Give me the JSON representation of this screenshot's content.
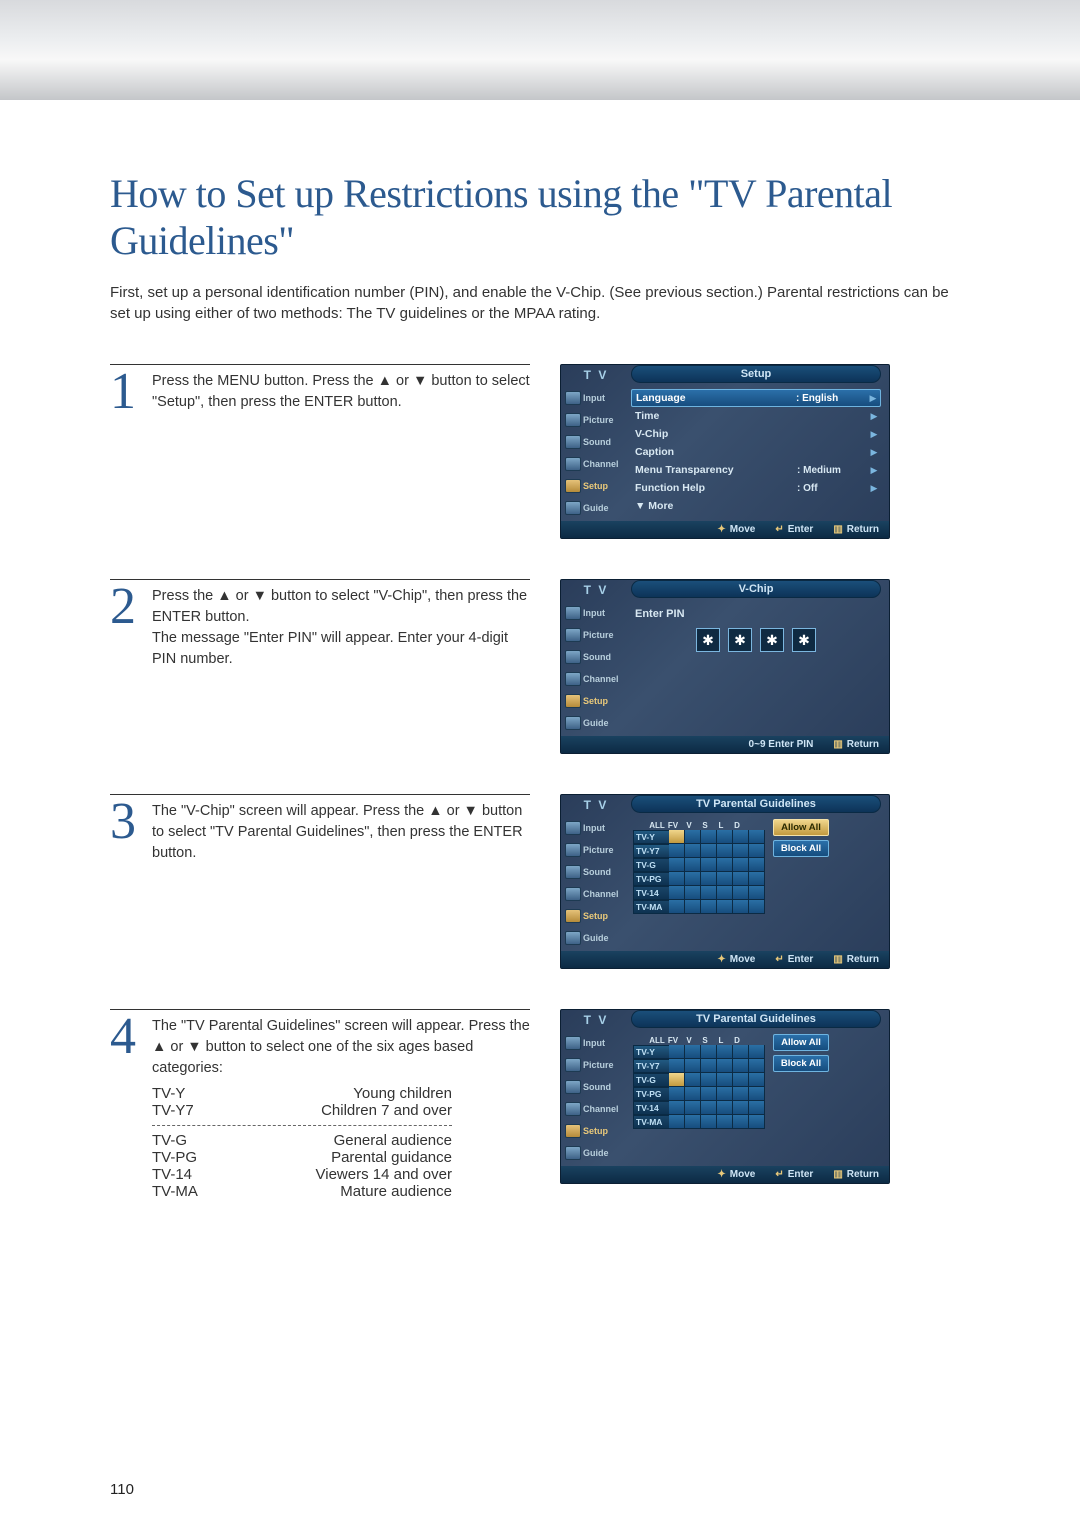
{
  "page_number": "110",
  "title": "How to Set up Restrictions using the \"TV Parental Guidelines\"",
  "intro": "First, set up a personal identification number (PIN), and enable the V-Chip. (See previous section.) Parental restrictions can be set up using either of two methods: The TV guidelines or the MPAA rating.",
  "steps": {
    "s1": {
      "num": "1",
      "text": "Press the MENU button. Press the ▲ or ▼ button to select \"Setup\", then press the ENTER button."
    },
    "s2": {
      "num": "2",
      "text": "Press the ▲ or ▼ button to select \"V-Chip\", then press the ENTER button.\nThe message \"Enter PIN\" will appear. Enter your 4-digit PIN number."
    },
    "s3": {
      "num": "3",
      "text": "The \"V-Chip\" screen will appear. Press the ▲ or ▼ button to select \"TV Parental Guidelines\", then press the ENTER button."
    },
    "s4": {
      "num": "4",
      "text": "The \"TV Parental Guidelines\" screen will appear. Press the ▲ or ▼ button to select one of the six ages based categories:"
    }
  },
  "osd_common": {
    "tv_label": "T V",
    "side": {
      "input": "Input",
      "picture": "Picture",
      "sound": "Sound",
      "channel": "Channel",
      "setup": "Setup",
      "guide": "Guide"
    },
    "foot": {
      "move": "Move",
      "enter": "Enter",
      "return": "Return",
      "enterpin": "0~9 Enter PIN"
    }
  },
  "osd1": {
    "title": "Setup",
    "rows": {
      "language": {
        "label": "Language",
        "value": ": English"
      },
      "time": {
        "label": "Time"
      },
      "vchip": {
        "label": "V-Chip"
      },
      "caption": {
        "label": "Caption"
      },
      "menutrans": {
        "label": "Menu Transparency",
        "value": ": Medium"
      },
      "funchelp": {
        "label": "Function Help",
        "value": ": Off"
      },
      "more": {
        "label": "▼ More"
      }
    }
  },
  "osd2": {
    "title": "V-Chip",
    "enter_pin": "Enter PIN",
    "pin": "✱"
  },
  "osd3": {
    "title": "TV Parental Guidelines"
  },
  "pg_cols": {
    "all": "ALL",
    "fv": "FV",
    "v": "V",
    "s": "S",
    "l": "L",
    "d": "D"
  },
  "pg_rows": {
    "y": "TV-Y",
    "y7": "TV-Y7",
    "g": "TV-G",
    "pg": "TV-PG",
    "r14": "TV-14",
    "ma": "TV-MA"
  },
  "pg_buttons": {
    "allow": "Allow All",
    "block": "Block All"
  },
  "categories": {
    "y": {
      "code": "TV-Y",
      "desc": "Young children"
    },
    "y7": {
      "code": "TV-Y7",
      "desc": "Children 7 and over"
    },
    "g": {
      "code": "TV-G",
      "desc": "General audience"
    },
    "pg": {
      "code": "TV-PG",
      "desc": "Parental guidance"
    },
    "r14": {
      "code": "TV-14",
      "desc": "Viewers 14 and over"
    },
    "ma": {
      "code": "TV-MA",
      "desc": "Mature audience"
    }
  }
}
